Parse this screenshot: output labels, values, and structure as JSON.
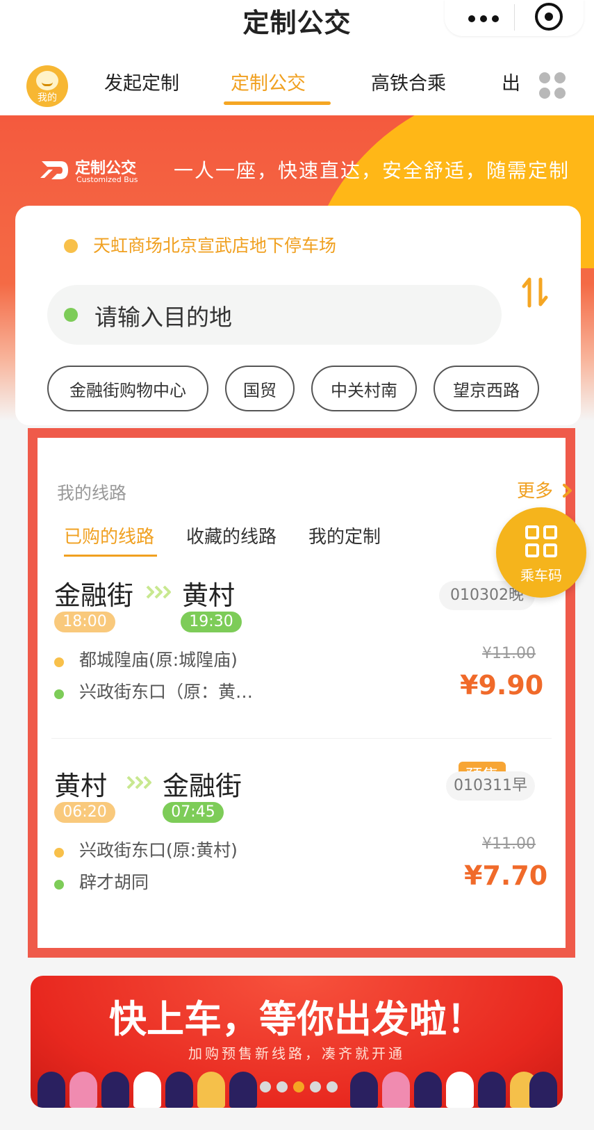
{
  "app": {
    "title": "定制公交"
  },
  "nav": {
    "avatar_label": "我的",
    "tabs": [
      {
        "label": "发起定制"
      },
      {
        "label": "定制公交"
      },
      {
        "label": "高铁合乘"
      },
      {
        "label": "出"
      }
    ],
    "active_tab": "定制公交"
  },
  "hero": {
    "logo_cn": "定制公交",
    "logo_en": "Customized Bus",
    "slogan": "一人一座，快速直达，安全舒适，随需定制"
  },
  "search": {
    "origin": "天虹商场北京宣武店地下停车场",
    "destination_placeholder": "请输入目的地",
    "quick_destinations": [
      "金融街购物中心",
      "国贸",
      "中关村南",
      "望京西路"
    ]
  },
  "routes": {
    "header": "我的线路",
    "more": "更多",
    "tabs": [
      {
        "label": "已购的线路"
      },
      {
        "label": "收藏的线路"
      },
      {
        "label": "我的定制"
      }
    ],
    "active_tab": "已购的线路",
    "items": [
      {
        "from": "金融街",
        "to": "黄村",
        "depart": "18:00",
        "arrive": "19:30",
        "code": "010302晚",
        "board_stop": "都城隍庙(原:城隍庙)",
        "alight_stop": "兴政街东口（原：黄…",
        "original_price": "¥11.00",
        "price": "¥9.90",
        "badge": ""
      },
      {
        "from": "黄村",
        "to": "金融街",
        "depart": "06:20",
        "arrive": "07:45",
        "code": "010311早",
        "board_stop": "兴政街东口(原:黄村)",
        "alight_stop": "辟才胡同",
        "original_price": "¥11.00",
        "price": "¥7.70",
        "badge": "预售"
      }
    ]
  },
  "fab": {
    "label": "乘车码",
    "icon": "qr-code-icon"
  },
  "promo": {
    "title": "快上车，等你出发啦！",
    "subtitle": "加购预售新线路，凑齐就开通",
    "page_count": 5,
    "active_page": 3
  },
  "colors": {
    "accent": "#f5a623",
    "hero_red": "#f45a3e",
    "hero_yellow": "#ffb717",
    "price": "#f06a2a",
    "green": "#7dcc58",
    "frame_red": "#ef5a4a"
  }
}
